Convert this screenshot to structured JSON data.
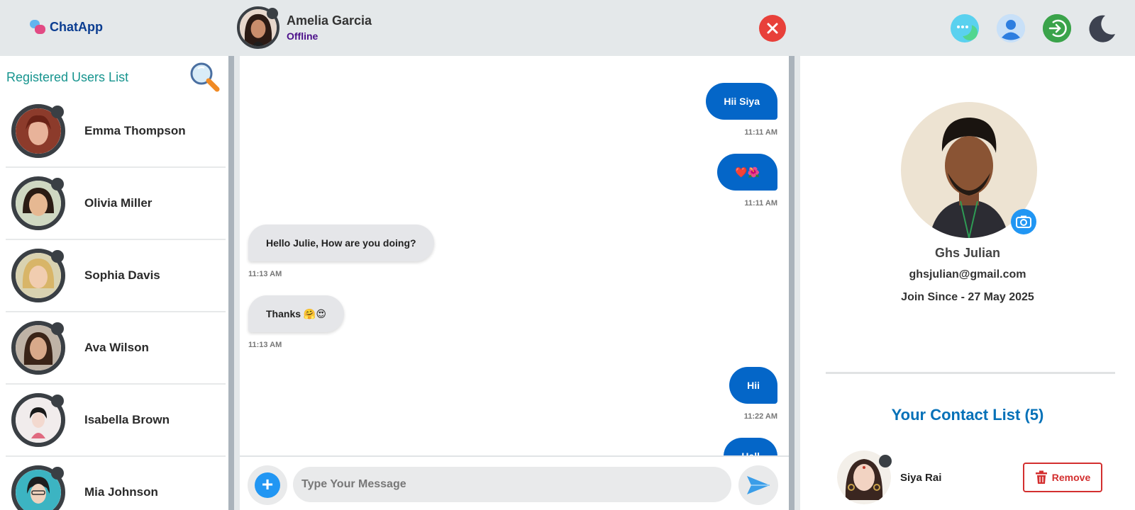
{
  "header": {
    "brand": "ChatApp",
    "chat_user": {
      "name": "Amelia Garcia",
      "status": "Offline"
    }
  },
  "sidebar": {
    "title": "Registered Users List",
    "users": [
      {
        "name": "Emma Thompson"
      },
      {
        "name": "Olivia Miller"
      },
      {
        "name": "Sophia Davis"
      },
      {
        "name": "Ava Wilson"
      },
      {
        "name": "Isabella Brown"
      },
      {
        "name": "Mia Johnson"
      }
    ]
  },
  "messages": [
    {
      "type": "sent",
      "text": "Hii Siya",
      "time": "11:11 AM"
    },
    {
      "type": "sent",
      "text": "❤️🌺",
      "time": "11:11 AM"
    },
    {
      "type": "received",
      "text": "Hello Julie, How are you doing?",
      "time": "11:13 AM"
    },
    {
      "type": "received",
      "text": "Thanks 🤗😍",
      "time": "11:13 AM"
    },
    {
      "type": "sent",
      "text": "Hii",
      "time": "11:22 AM"
    },
    {
      "type": "sent",
      "text": "Hell",
      "time": ""
    }
  ],
  "composer": {
    "placeholder": "Type Your Message"
  },
  "profile": {
    "name": "Ghs Julian",
    "email": "ghsjulian@gmail.com",
    "join": "Join Since - 27 May 2025",
    "contact_title": "Your Contact List (5)",
    "contacts": [
      {
        "name": "Siya Rai",
        "action": "Remove"
      }
    ]
  },
  "colors": {
    "accent_blue": "#0466c8",
    "sidebar_title": "#16948e",
    "offline_status": "#4b0f8a",
    "close_red": "#e8403a",
    "remove_red": "#d32f2f"
  },
  "icons": [
    "chat-bubble-icon",
    "search-icon",
    "close-icon",
    "messages-icon",
    "profile-icon",
    "logout-icon",
    "moon-icon",
    "plus-icon",
    "send-icon",
    "camera-icon",
    "trash-icon"
  ]
}
